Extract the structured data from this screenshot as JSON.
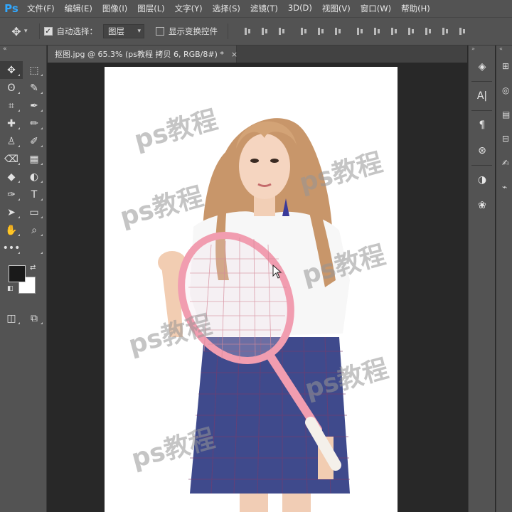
{
  "app": {
    "logo": "Ps",
    "menu": [
      "文件(F)",
      "编辑(E)",
      "图像(I)",
      "图层(L)",
      "文字(Y)",
      "选择(S)",
      "滤镜(T)",
      "3D(D)",
      "视图(V)",
      "窗口(W)",
      "帮助(H)"
    ]
  },
  "options": {
    "auto_select_label": "自动选择：",
    "auto_select_checked": true,
    "auto_select_value": "图层",
    "show_transform_label": "显示变换控件",
    "show_transform_checked": false
  },
  "document": {
    "tab_title": "抠图.jpg @ 65.3% (ps教程 拷贝 6, RGB/8#) *",
    "close_glyph": "×",
    "watermark_text": "ps教程"
  },
  "toolbar": {
    "head_glyph": "«",
    "tools": [
      {
        "name": "move-tool",
        "glyph": "✥"
      },
      {
        "name": "marquee-tool",
        "glyph": "⬚"
      },
      {
        "name": "lasso-tool",
        "glyph": "ʘ"
      },
      {
        "name": "quick-select-tool",
        "glyph": "✎"
      },
      {
        "name": "crop-tool",
        "glyph": "⌗"
      },
      {
        "name": "eyedropper-tool",
        "glyph": "✒"
      },
      {
        "name": "healing-brush-tool",
        "glyph": "✚"
      },
      {
        "name": "brush-tool",
        "glyph": "✏"
      },
      {
        "name": "clone-stamp-tool",
        "glyph": "♙"
      },
      {
        "name": "history-brush-tool",
        "glyph": "✐"
      },
      {
        "name": "eraser-tool",
        "glyph": "⌫"
      },
      {
        "name": "gradient-tool",
        "glyph": "▦"
      },
      {
        "name": "blur-tool",
        "glyph": "◆"
      },
      {
        "name": "dodge-tool",
        "glyph": "◐"
      },
      {
        "name": "pen-tool",
        "glyph": "✑"
      },
      {
        "name": "type-tool",
        "glyph": "T"
      },
      {
        "name": "path-select-tool",
        "glyph": "➤"
      },
      {
        "name": "rectangle-tool",
        "glyph": "▭"
      },
      {
        "name": "hand-tool",
        "glyph": "✋"
      },
      {
        "name": "zoom-tool",
        "glyph": "⌕"
      },
      {
        "name": "more-tools",
        "glyph": "•••"
      },
      {
        "name": "empty-slot",
        "glyph": ""
      }
    ],
    "fg_color": "#1a1a1a",
    "bg_color": "#ffffff"
  },
  "panels": {
    "strip1_head": "»",
    "strip1": [
      {
        "name": "layers-panel-icon",
        "glyph": "◈"
      },
      {
        "name": "character-panel-icon",
        "glyph": "A|"
      },
      {
        "name": "paragraph-panel-icon",
        "glyph": "¶"
      },
      {
        "name": "glyph-panel-icon",
        "glyph": "⊛"
      },
      {
        "name": "adjustments-panel-icon",
        "glyph": "◑"
      },
      {
        "name": "channels-panel-icon",
        "glyph": "❀"
      }
    ],
    "strip2_head": "«",
    "strip2": [
      {
        "name": "color-panel-icon",
        "glyph": "⊞"
      },
      {
        "name": "styles-panel-icon",
        "glyph": "◎"
      },
      {
        "name": "swatches-panel-icon",
        "glyph": "▤"
      },
      {
        "name": "grid-panel-icon",
        "glyph": "⊟"
      },
      {
        "name": "brush-panel-icon",
        "glyph": "✍"
      },
      {
        "name": "path-panel-icon",
        "glyph": "⌁"
      }
    ]
  }
}
